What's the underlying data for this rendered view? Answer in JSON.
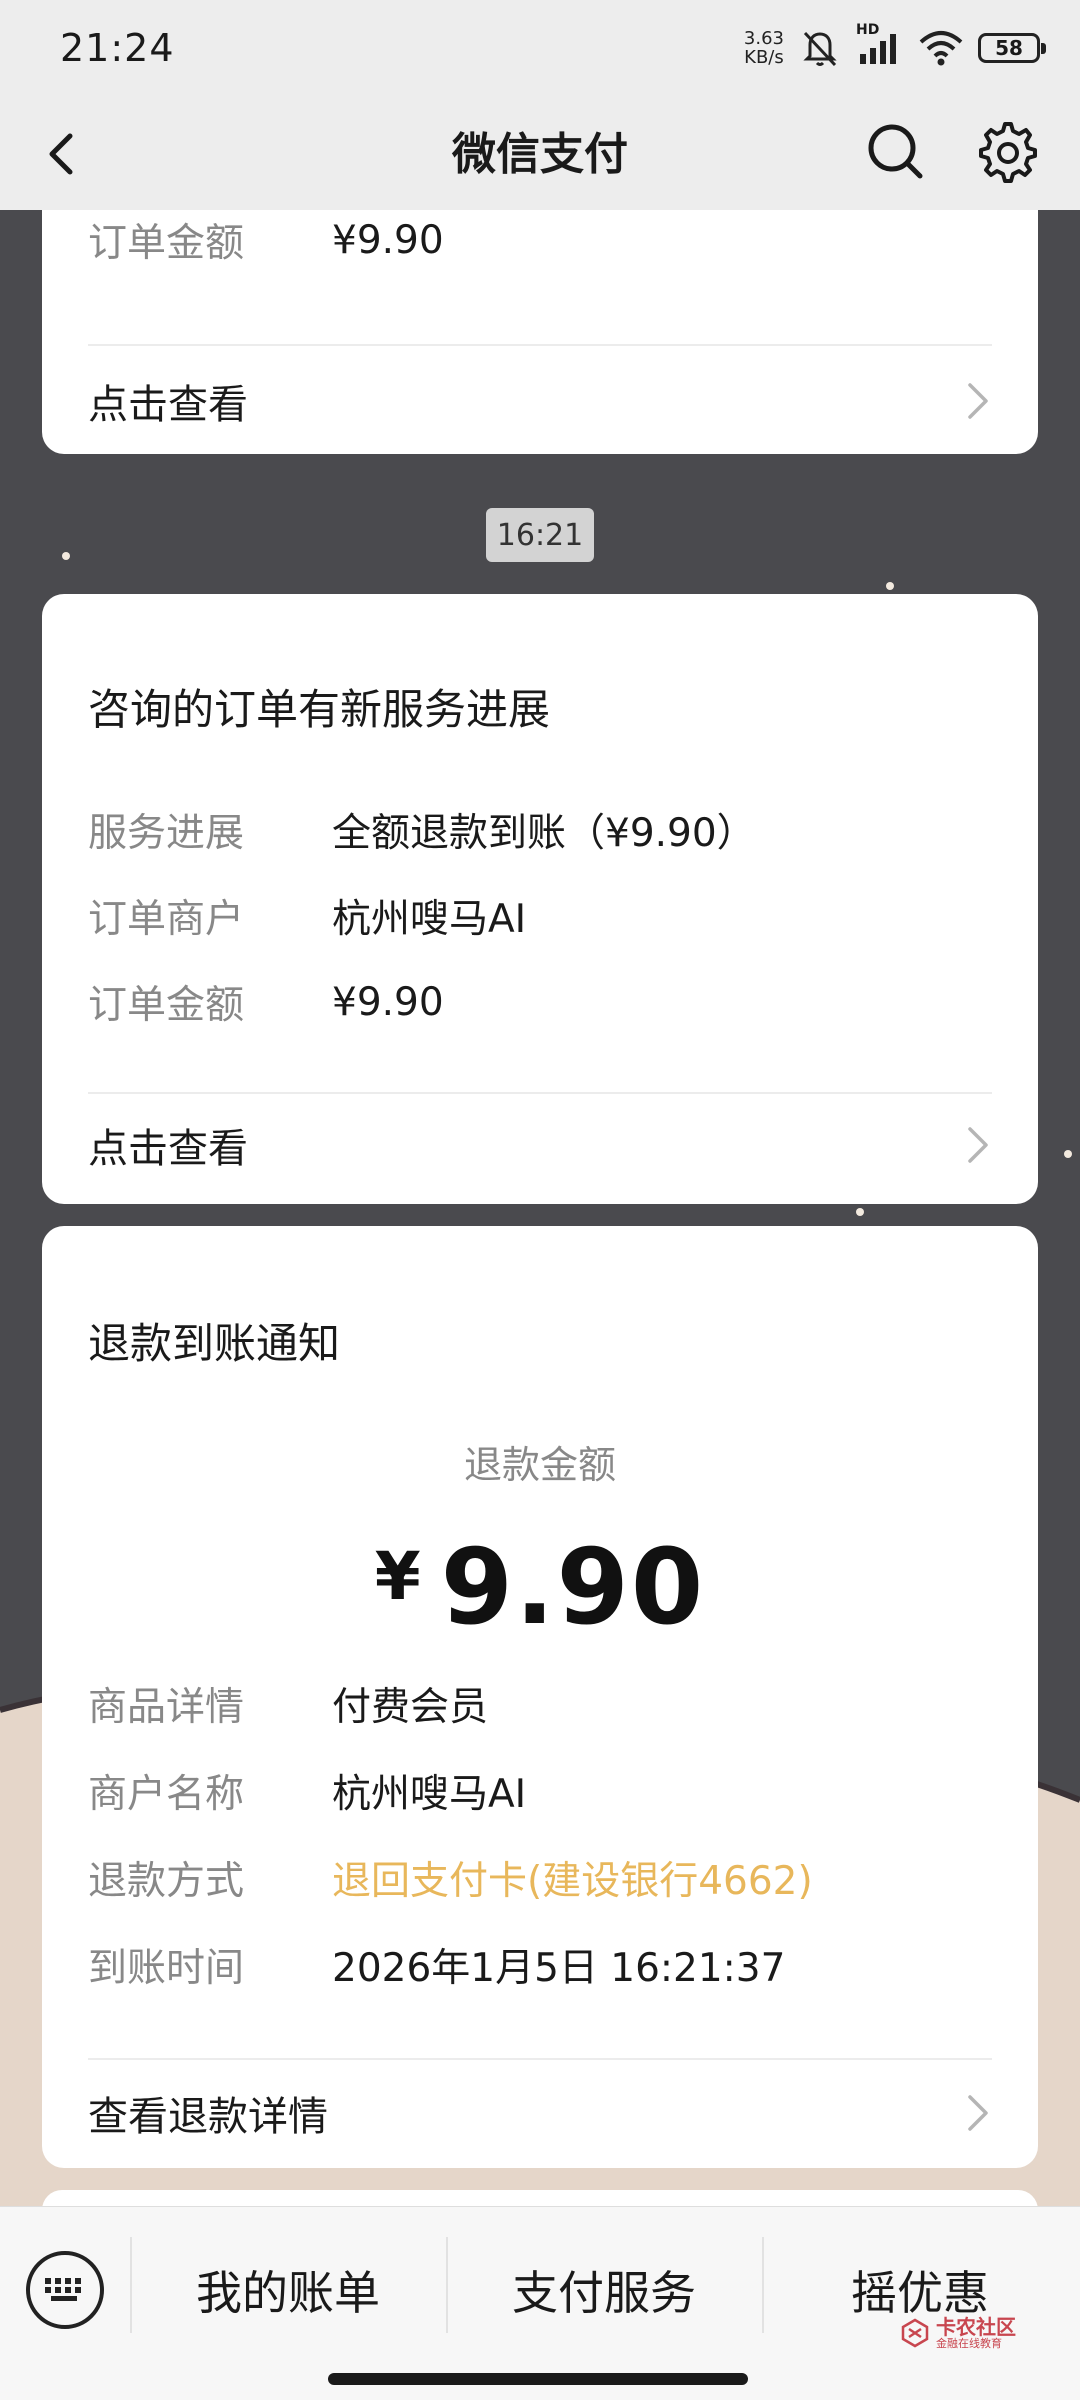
{
  "status_bar": {
    "time": "21:24",
    "net_speed_value": "3.63",
    "net_speed_unit": "KB/s",
    "hd_label": "HD",
    "battery": "58"
  },
  "header": {
    "title": "微信支付",
    "icons": [
      "back-icon",
      "search-icon",
      "gear-icon"
    ]
  },
  "card_top": {
    "amount_label": "订单金额",
    "amount_value": "¥9.90",
    "link_text": "点击查看"
  },
  "timestamp": "16:21",
  "card_service": {
    "title": "咨询的订单有新服务进展",
    "rows": [
      {
        "label": "服务进展",
        "value": "全额退款到账（¥9.90）"
      },
      {
        "label": "订单商户",
        "value": "杭州嗖马AI"
      },
      {
        "label": "订单金额",
        "value": "¥9.90"
      }
    ],
    "link_text": "点击查看"
  },
  "card_refund": {
    "title": "退款到账通知",
    "amount_label": "退款金额",
    "currency": "¥",
    "amount": "9.90",
    "rows": [
      {
        "label": "商品详情",
        "value": "付费会员"
      },
      {
        "label": "商户名称",
        "value": "杭州嗖马AI"
      },
      {
        "label": "退款方式",
        "value": "退回支付卡(建设银行4662)"
      },
      {
        "label": "到账时间",
        "value": "2026年1月5日 16:21:37"
      }
    ],
    "link_text": "查看退款详情",
    "highlight_color": "#e8b75b"
  },
  "bottom_bar": {
    "items": [
      "我的账单",
      "支付服务",
      "摇优惠"
    ]
  },
  "watermark": {
    "main": "卡农社区",
    "sub": "金融在线教育"
  }
}
